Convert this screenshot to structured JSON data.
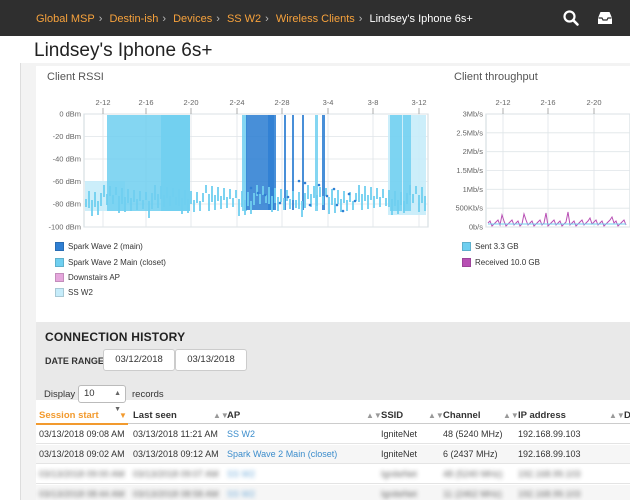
{
  "breadcrumb": {
    "items": [
      "Global MSP",
      "Destin-ish",
      "Devices",
      "SS W2",
      "Wireless Clients"
    ],
    "current": "Lindsey's Iphone 6s+"
  },
  "page": {
    "title": "Lindsey's Iphone 6s+"
  },
  "icons": {
    "search": "search-icon",
    "inbox": "inbox-icon"
  },
  "rssi_chart": {
    "title": "Client RSSI",
    "x_ticks": [
      "2-12",
      "2-16",
      "2-20",
      "2-24",
      "2-28",
      "3-4",
      "3-8",
      "3-12"
    ],
    "y_ticks": [
      "0 dBm",
      "-20 dBm",
      "-40 dBm",
      "-60 dBm",
      "-80 dBm",
      "-100 dBm"
    ],
    "legend": [
      {
        "label": "Spark Wave 2 (main)",
        "color": "#2f7fd3"
      },
      {
        "label": "Spark Wave 2 Main (closet)",
        "color": "#6fcff0"
      },
      {
        "label": "Downstairs AP",
        "color": "#e5a6dc"
      },
      {
        "label": "SS W2",
        "color": "#c6ecfa"
      }
    ]
  },
  "throughput_chart": {
    "title": "Client throughput",
    "x_ticks": [
      "2-12",
      "2-16",
      "2-20"
    ],
    "y_ticks": [
      "3Mb/s",
      "2.5Mb/s",
      "2Mb/s",
      "1.5Mb/s",
      "1Mb/s",
      "500Kb/s",
      "0b/s"
    ],
    "legend": [
      {
        "label": "Sent 3.3 GB",
        "color": "#6fcff0"
      },
      {
        "label": "Received 10.0 GB",
        "color": "#b84fb4"
      }
    ]
  },
  "connection_history": {
    "title": "CONNECTION HISTORY",
    "date_range_label": "DATE RANGE",
    "date_from": "03/12/2018",
    "date_to": "03/13/2018",
    "display_label": "Display",
    "display_value": "10",
    "records_label": "records",
    "columns": [
      "Session start",
      "Last seen",
      "AP",
      "SSID",
      "Channel",
      "IP address",
      "D"
    ],
    "rows": [
      {
        "session_start": "03/13/2018 09:08 AM",
        "last_seen": "03/13/2018 11:21 AM",
        "ap": "SS W2",
        "ssid": "IgniteNet",
        "channel": "48 (5240 MHz)",
        "ip": "192.168.99.103"
      },
      {
        "session_start": "03/13/2018 09:02 AM",
        "last_seen": "03/13/2018 09:12 AM",
        "ap": "Spark Wave 2 Main (closet)",
        "ssid": "IgniteNet",
        "channel": "6 (2437 MHz)",
        "ip": "192.168.99.103"
      },
      {
        "session_start": "03/13/2018 09:00 AM",
        "last_seen": "03/13/2018 09:07 AM",
        "ap": "SS W2",
        "ssid": "IgniteNet",
        "channel": "48 (5240 MHz)",
        "ip": "192.168.99.103"
      },
      {
        "session_start": "03/13/2018 08:44 AM",
        "last_seen": "03/13/2018 08:58 AM",
        "ap": "SS W2",
        "ssid": "IgniteNet",
        "channel": "11 (2462 MHz)",
        "ip": "192.168.99.103"
      }
    ]
  }
}
